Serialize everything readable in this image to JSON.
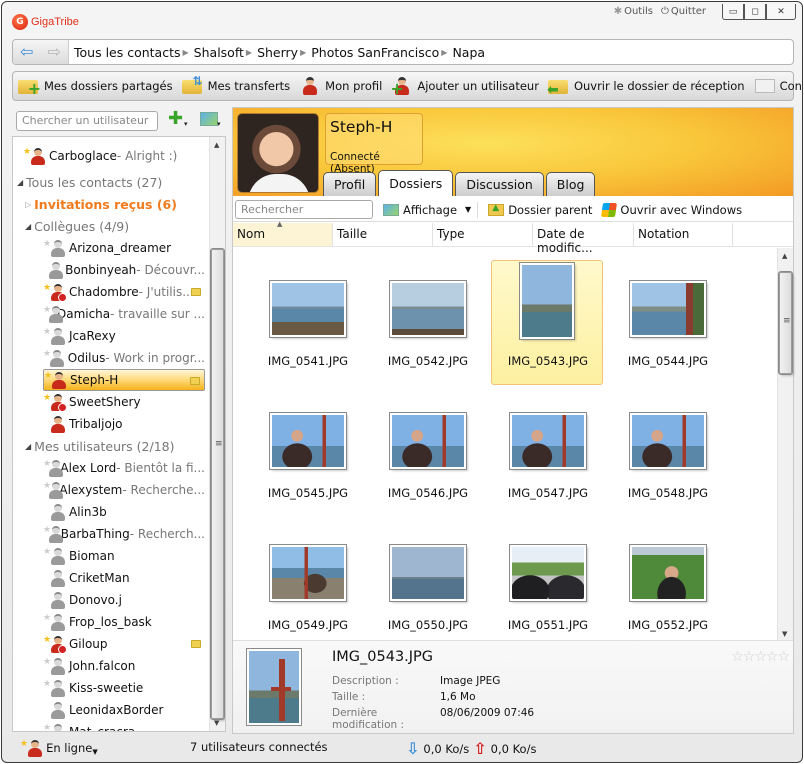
{
  "app": {
    "title": "GigaTribe",
    "logo_glyph": "G",
    "top_links": [
      {
        "label": "Outils",
        "icon": "gear-icon",
        "glyph": "✱"
      },
      {
        "label": "Quitter",
        "icon": "power-icon",
        "glyph": "⏻"
      }
    ],
    "window_controls": {
      "minimize": "▭",
      "maximize": "◻",
      "close": "✕"
    }
  },
  "breadcrumb": {
    "back_glyph": "⇦",
    "forward_glyph": "⇨",
    "separator": "▶",
    "items": [
      "Tous les contacts",
      "Shalsoft",
      "Sherry",
      "Photos SanFrancisco",
      "Napa"
    ]
  },
  "toolbar": {
    "items": [
      {
        "label": "Mes dossiers partagés",
        "icon": "shared-folders-icon"
      },
      {
        "label": "Mes transferts",
        "icon": "transfers-icon"
      },
      {
        "label": "Mon profil",
        "icon": "profile-icon"
      },
      {
        "label": "Ajouter un utilisateur",
        "icon": "add-user-icon"
      },
      {
        "label": "Ouvrir le dossier de réception",
        "icon": "inbox-folder-icon"
      },
      {
        "label": "Contactez-Nous",
        "icon": "envelope-icon"
      }
    ]
  },
  "contacts_panel": {
    "search_placeholder": "Chercher un utilisateur",
    "add_glyph": "✚",
    "dropdown_glyph": "▾",
    "pinned": {
      "name": "Carboglace",
      "message": " - Alright :)",
      "star": true,
      "status": "online"
    },
    "groups": [
      {
        "label": "Tous les contacts (27)",
        "expanded": true
      },
      {
        "label": "Invitations reçus (6)",
        "expanded": false
      },
      {
        "label": "Collègues (4/9)",
        "expanded": true
      },
      {
        "label": "Mes utilisateurs (2/18)",
        "expanded": true
      }
    ],
    "collegues": [
      {
        "name": "Arizona_dreamer",
        "message": "",
        "star": false,
        "status": "offline",
        "folder": false
      },
      {
        "name": "Bonbinyeah",
        "message": " - Découvr...",
        "star": null,
        "status": "offline",
        "folder": false
      },
      {
        "name": "Chadombre",
        "message": " - J'utilis...",
        "star": true,
        "status": "blocked",
        "folder": true
      },
      {
        "name": "Damicha",
        "message": " - travaille sur ...",
        "star": false,
        "status": "offline",
        "folder": false
      },
      {
        "name": "JcaRexy",
        "message": "",
        "star": false,
        "status": "offline",
        "folder": false
      },
      {
        "name": "Odilus",
        "message": " - Work in progr...",
        "star": false,
        "status": "offline",
        "folder": false
      },
      {
        "name": "Steph-H",
        "message": "",
        "star": true,
        "status": "online",
        "folder": true,
        "selected": true
      },
      {
        "name": "SweetShery",
        "message": "",
        "star": true,
        "status": "blocked",
        "folder": false
      },
      {
        "name": "Tribaljojo",
        "message": "",
        "star": null,
        "status": "online",
        "folder": false
      }
    ],
    "utilisateurs": [
      {
        "name": "Alex Lord",
        "message": " - Bientôt la fi...",
        "star": false,
        "status": "offline",
        "folder": false
      },
      {
        "name": "Alexystem",
        "message": " - Recherche...",
        "star": false,
        "status": "offline",
        "folder": false
      },
      {
        "name": "Alin3b",
        "message": "",
        "star": null,
        "status": "offline",
        "folder": false
      },
      {
        "name": "BarbaThing",
        "message": " - Recherch...",
        "star": false,
        "status": "offline",
        "folder": false
      },
      {
        "name": "Bioman",
        "message": "",
        "star": false,
        "status": "offline",
        "folder": false
      },
      {
        "name": "CriketMan",
        "message": "",
        "star": null,
        "status": "offline",
        "folder": false
      },
      {
        "name": "Donovo.j",
        "message": "",
        "star": null,
        "status": "offline",
        "folder": false
      },
      {
        "name": "Frop_los_bask",
        "message": "",
        "star": false,
        "status": "offline",
        "folder": false
      },
      {
        "name": "Giloup",
        "message": "",
        "star": true,
        "status": "blocked",
        "folder": true
      },
      {
        "name": "John.falcon",
        "message": "",
        "star": false,
        "status": "offline",
        "folder": false
      },
      {
        "name": "Kiss-sweetie",
        "message": "",
        "star": false,
        "status": "offline",
        "folder": false
      },
      {
        "name": "LeonidaxBorder",
        "message": "",
        "star": null,
        "status": "offline",
        "folder": false
      },
      {
        "name": "Mat_cracra",
        "message": "",
        "star": false,
        "status": "offline",
        "folder": false
      }
    ]
  },
  "profile": {
    "name": "Steph-H",
    "status": "Connecté (Absent)",
    "tabs": [
      "Profil",
      "Dossiers",
      "Discussion",
      "Blog"
    ],
    "active_tab": "Dossiers"
  },
  "files": {
    "search_placeholder": "Rechercher",
    "actions": {
      "view": "Affichage",
      "parent": "Dossier parent",
      "open_windows": "Ouvrir avec Windows"
    },
    "columns": [
      "Nom",
      "Taille",
      "Type",
      "Date de modific...",
      "Notation"
    ],
    "sorted_column": "Nom",
    "items": [
      {
        "name": "IMG_0541.JPG",
        "orientation": "landscape",
        "scene": "bay",
        "selected": false
      },
      {
        "name": "IMG_0542.JPG",
        "orientation": "landscape",
        "scene": "island",
        "selected": false
      },
      {
        "name": "IMG_0543.JPG",
        "orientation": "portrait",
        "scene": "bridge",
        "selected": true
      },
      {
        "name": "IMG_0544.JPG",
        "orientation": "landscape",
        "scene": "bridge-side",
        "selected": false
      },
      {
        "name": "IMG_0545.JPG",
        "orientation": "landscape",
        "scene": "person-bridge",
        "selected": false
      },
      {
        "name": "IMG_0546.JPG",
        "orientation": "landscape",
        "scene": "person-bridge",
        "selected": false
      },
      {
        "name": "IMG_0547.JPG",
        "orientation": "landscape",
        "scene": "person-bridge",
        "selected": false
      },
      {
        "name": "IMG_0548.JPG",
        "orientation": "landscape",
        "scene": "person-bridge",
        "selected": false
      },
      {
        "name": "IMG_0549.JPG",
        "orientation": "landscape",
        "scene": "person-path",
        "selected": false
      },
      {
        "name": "IMG_0550.JPG",
        "orientation": "landscape",
        "scene": "sea",
        "selected": false
      },
      {
        "name": "IMG_0551.JPG",
        "orientation": "landscape",
        "scene": "two-people",
        "selected": false
      },
      {
        "name": "IMG_0552.JPG",
        "orientation": "landscape",
        "scene": "person-garden",
        "selected": false
      }
    ]
  },
  "details": {
    "title": "IMG_0543.JPG",
    "rows": [
      {
        "key": "Description :",
        "value": "Image JPEG"
      },
      {
        "key": "Taille :",
        "value": "1,6 Mo"
      },
      {
        "key": "Dernière modification :",
        "value": "08/06/2009 07:46"
      }
    ],
    "rating": 0,
    "rating_max": 5,
    "star_glyph": "☆"
  },
  "statusbar": {
    "presence": "En ligne",
    "connected": "7 utilisateurs connectés",
    "download": "0,0 Ko/s",
    "upload": "0,0 Ko/s",
    "down_glyph": "⇩",
    "up_glyph": "⇧"
  },
  "colors": {
    "accent_orange": "#f07b1e",
    "selection_yellow": "#ffd978",
    "profile_header": "#f9c63a",
    "logo_red": "#e0301a"
  }
}
